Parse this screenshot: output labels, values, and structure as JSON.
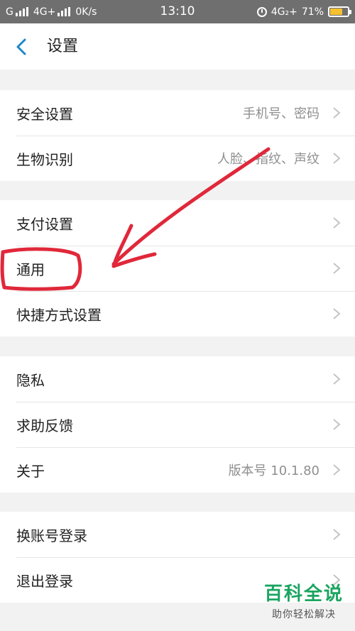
{
  "status_bar": {
    "carrier": "G",
    "network": "4G+",
    "speed": "0K/s",
    "time": "13:10",
    "network_right": "4G₂+",
    "battery": "71%",
    "battery_level": 0.71
  },
  "header": {
    "title": "设置"
  },
  "groups": [
    {
      "items": [
        {
          "label": "安全设置",
          "value": "手机号、密码"
        },
        {
          "label": "生物识别",
          "value": "人脸、指纹、声纹"
        }
      ]
    },
    {
      "items": [
        {
          "label": "支付设置",
          "value": ""
        },
        {
          "label": "通用",
          "value": ""
        },
        {
          "label": "快捷方式设置",
          "value": ""
        }
      ]
    },
    {
      "items": [
        {
          "label": "隐私",
          "value": ""
        },
        {
          "label": "求助反馈",
          "value": ""
        },
        {
          "label": "关于",
          "value": "版本号 10.1.80"
        }
      ]
    },
    {
      "items": [
        {
          "label": "换账号登录",
          "value": ""
        },
        {
          "label": "退出登录",
          "value": ""
        }
      ]
    }
  ],
  "watermark": {
    "title": "百科全说",
    "subtitle": "助你轻松解决"
  },
  "colors": {
    "accent": "#1e88c8",
    "annotation": "#e0283a",
    "watermark": "#1aa560"
  }
}
